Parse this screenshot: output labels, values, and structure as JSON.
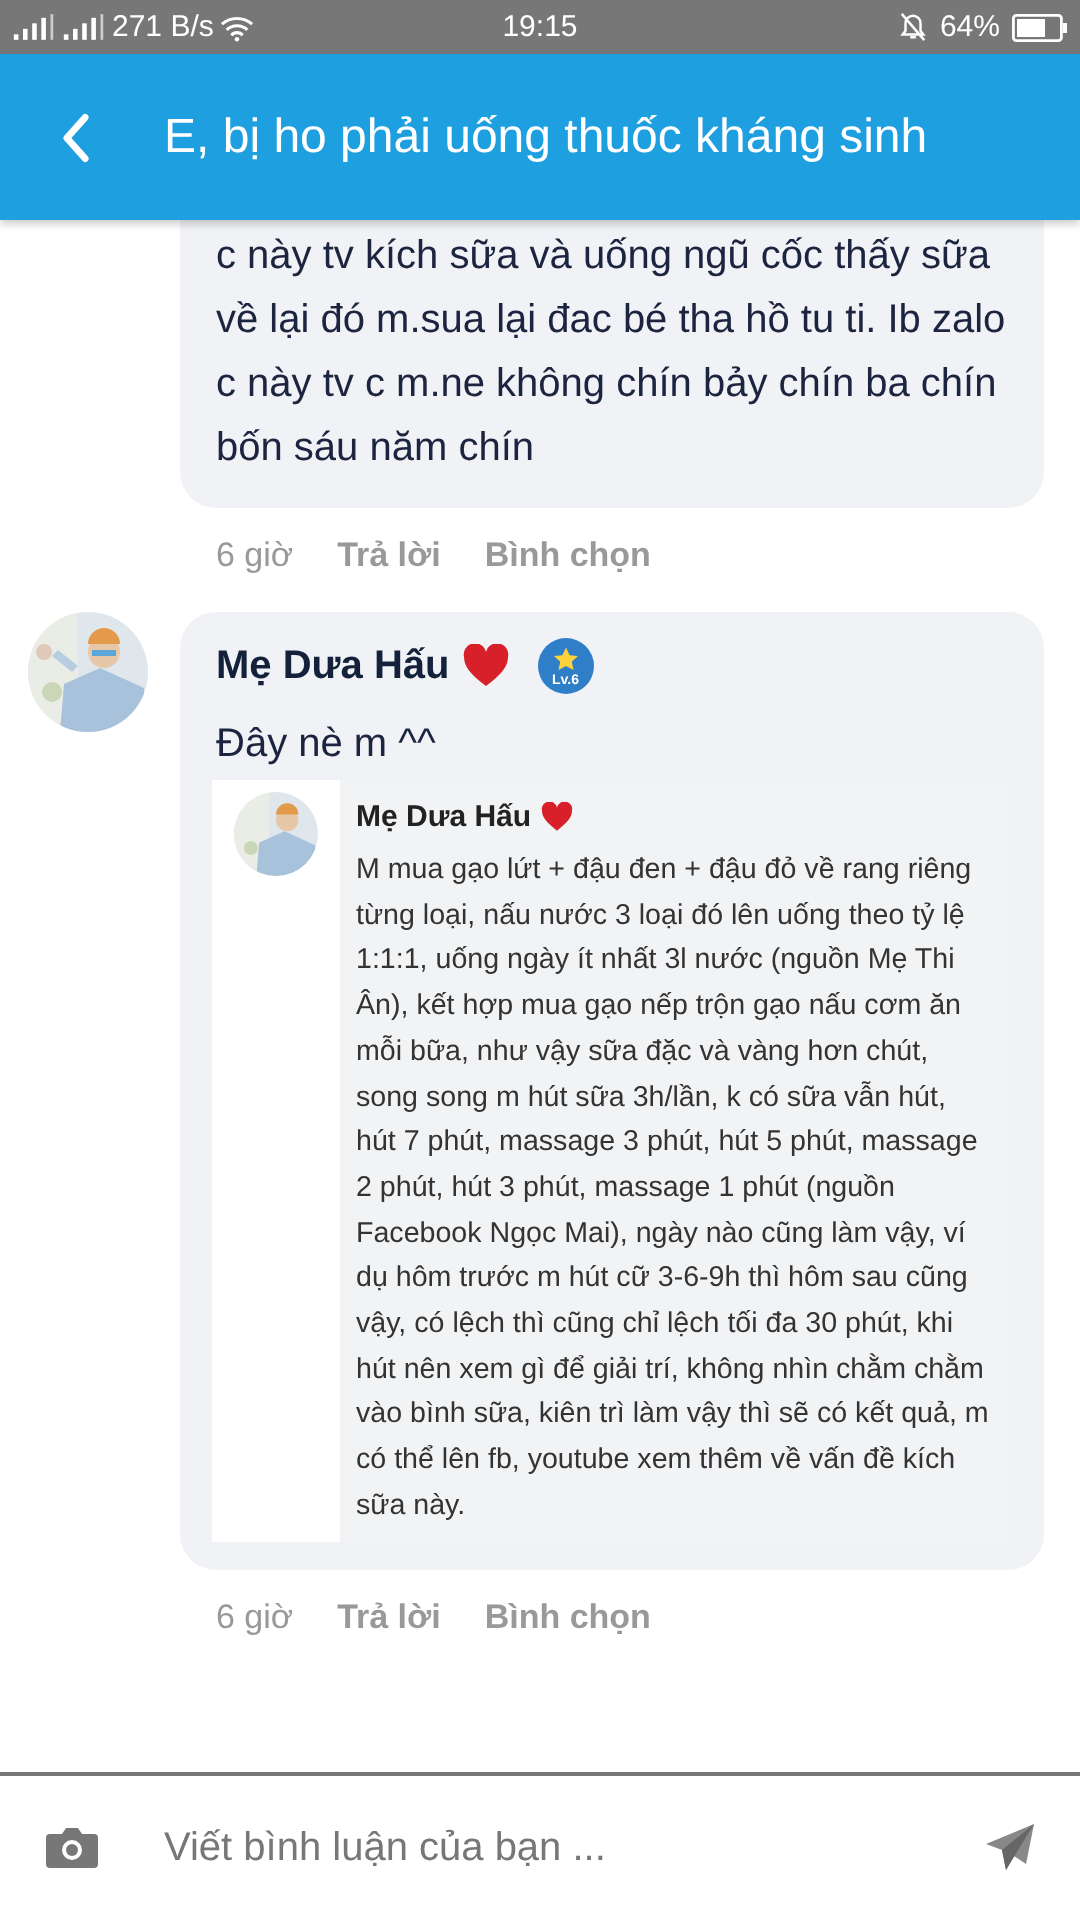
{
  "status_bar": {
    "network_speed": "271 B/s",
    "time": "19:15",
    "battery": "64%"
  },
  "header": {
    "title": "E, bị ho phải uống thuốc kháng sinh"
  },
  "comments": [
    {
      "text": "c này tv kích sữa và uống ngũ cốc thấy sữa về lại đó m.sua lại đac bé tha hồ tu ti. Ib zalo c này tv c m.ne không chín bảy chín ba chín bốn sáu năm chín",
      "time": "6 giờ",
      "actions": [
        "Trả lời",
        "Bình chọn"
      ]
    },
    {
      "author": "Mẹ Dưa Hấu",
      "badge": "Lv.6",
      "text": "Đây nè m ^^",
      "attachment": {
        "author": "Mẹ Dưa Hấu",
        "text": "M mua gạo lứt + đậu đen + đậu đỏ về rang riêng từng loại, nấu nước 3 loại đó lên uống theo tỷ lệ 1:1:1, uống ngày ít nhất 3l nước (nguồn Mẹ Thi Ân), kết hợp mua gạo nếp trộn gạo nấu cơm ăn mỗi bữa, như vậy sữa đặc và vàng hơn chút, song song m hút sữa 3h/lần, k có sữa vẫn hút, hút 7 phút, massage 3 phút, hút 5 phút, massage 2 phút, hút 3 phút, massage 1 phút (nguồn Facebook Ngọc Mai), ngày nào cũng làm vậy, ví dụ hôm trước m hút cữ 3-6-9h thì hôm sau cũng vậy, có lệch thì cũng chỉ lệch tối đa 30 phút, khi hút nên xem gì để giải trí, không nhìn chằm chằm vào bình sữa, kiên trì làm vậy thì sẽ có kết quả, m có thể lên fb, youtube xem thêm về vấn đề kích sữa này."
      },
      "time": "6 giờ",
      "actions": [
        "Trả lời",
        "Bình chọn"
      ]
    }
  ],
  "composer": {
    "placeholder": "Viết bình luận của bạn ..."
  }
}
